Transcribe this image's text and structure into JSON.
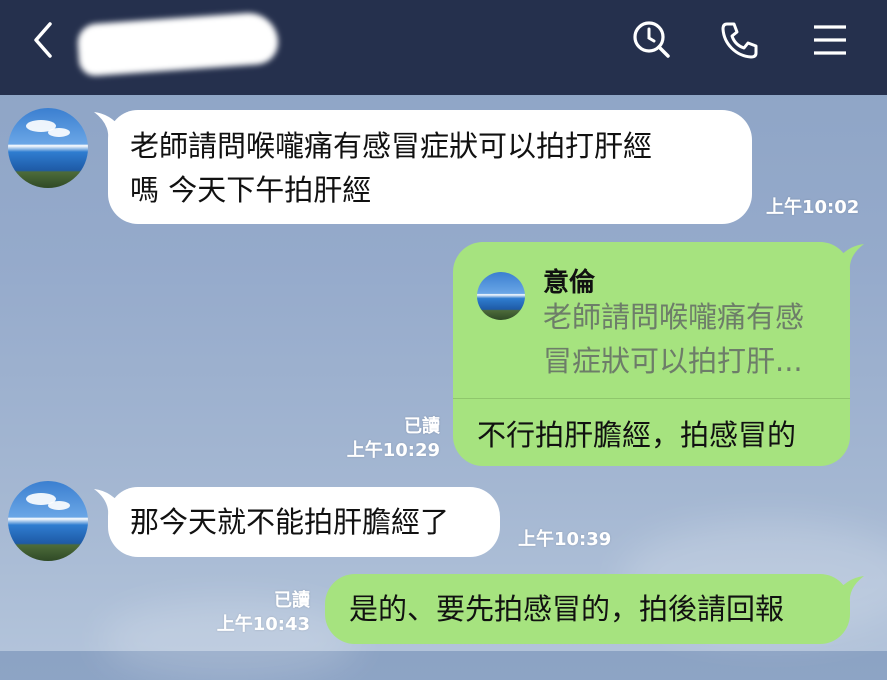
{
  "header": {
    "contact_name": "意",
    "icons": [
      "back-arrow-icon",
      "search-icon",
      "phone-icon",
      "menu-icon"
    ]
  },
  "messages": [
    {
      "side": "left",
      "text_line1": "老師請問喉嚨痛有感冒症狀可以拍打肝經",
      "text_line2": "嗎 今天下午拍肝經",
      "time": "上午10:02"
    },
    {
      "side": "right",
      "reply_to": {
        "name": "意倫",
        "quote_line1": "老師請問喉嚨痛有感",
        "quote_line2": "冒症狀可以拍打肝..."
      },
      "text": "不行拍肝膽經，拍感冒的",
      "read": "已讀",
      "time": "上午10:29"
    },
    {
      "side": "left",
      "text": "那今天就不能拍肝膽經了",
      "time": "上午10:39"
    },
    {
      "side": "right",
      "text": "是的、要先拍感冒的，拍後請回報",
      "read": "已讀",
      "time": "上午10:43"
    }
  ],
  "colors": {
    "header_bg": "#25304d",
    "chat_bg": "#95aacb",
    "bubble_in": "#ffffff",
    "bubble_out": "#a6e37f"
  }
}
